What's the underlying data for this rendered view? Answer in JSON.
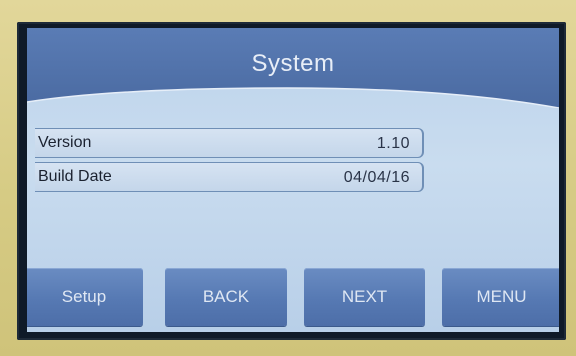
{
  "header": {
    "title": "System"
  },
  "info": {
    "rows": [
      {
        "label": "Version",
        "value": "1.10"
      },
      {
        "label": "Build Date",
        "value": "04/04/16"
      }
    ]
  },
  "buttons": {
    "setup": "Setup",
    "back": "BACK",
    "next": "NEXT",
    "menu": "MENU"
  },
  "colors": {
    "header_blue": "#4f6fa6",
    "button_blue": "#5679b3",
    "background_light_blue": "#c9dcef",
    "bezel": "#d9cf8a"
  }
}
